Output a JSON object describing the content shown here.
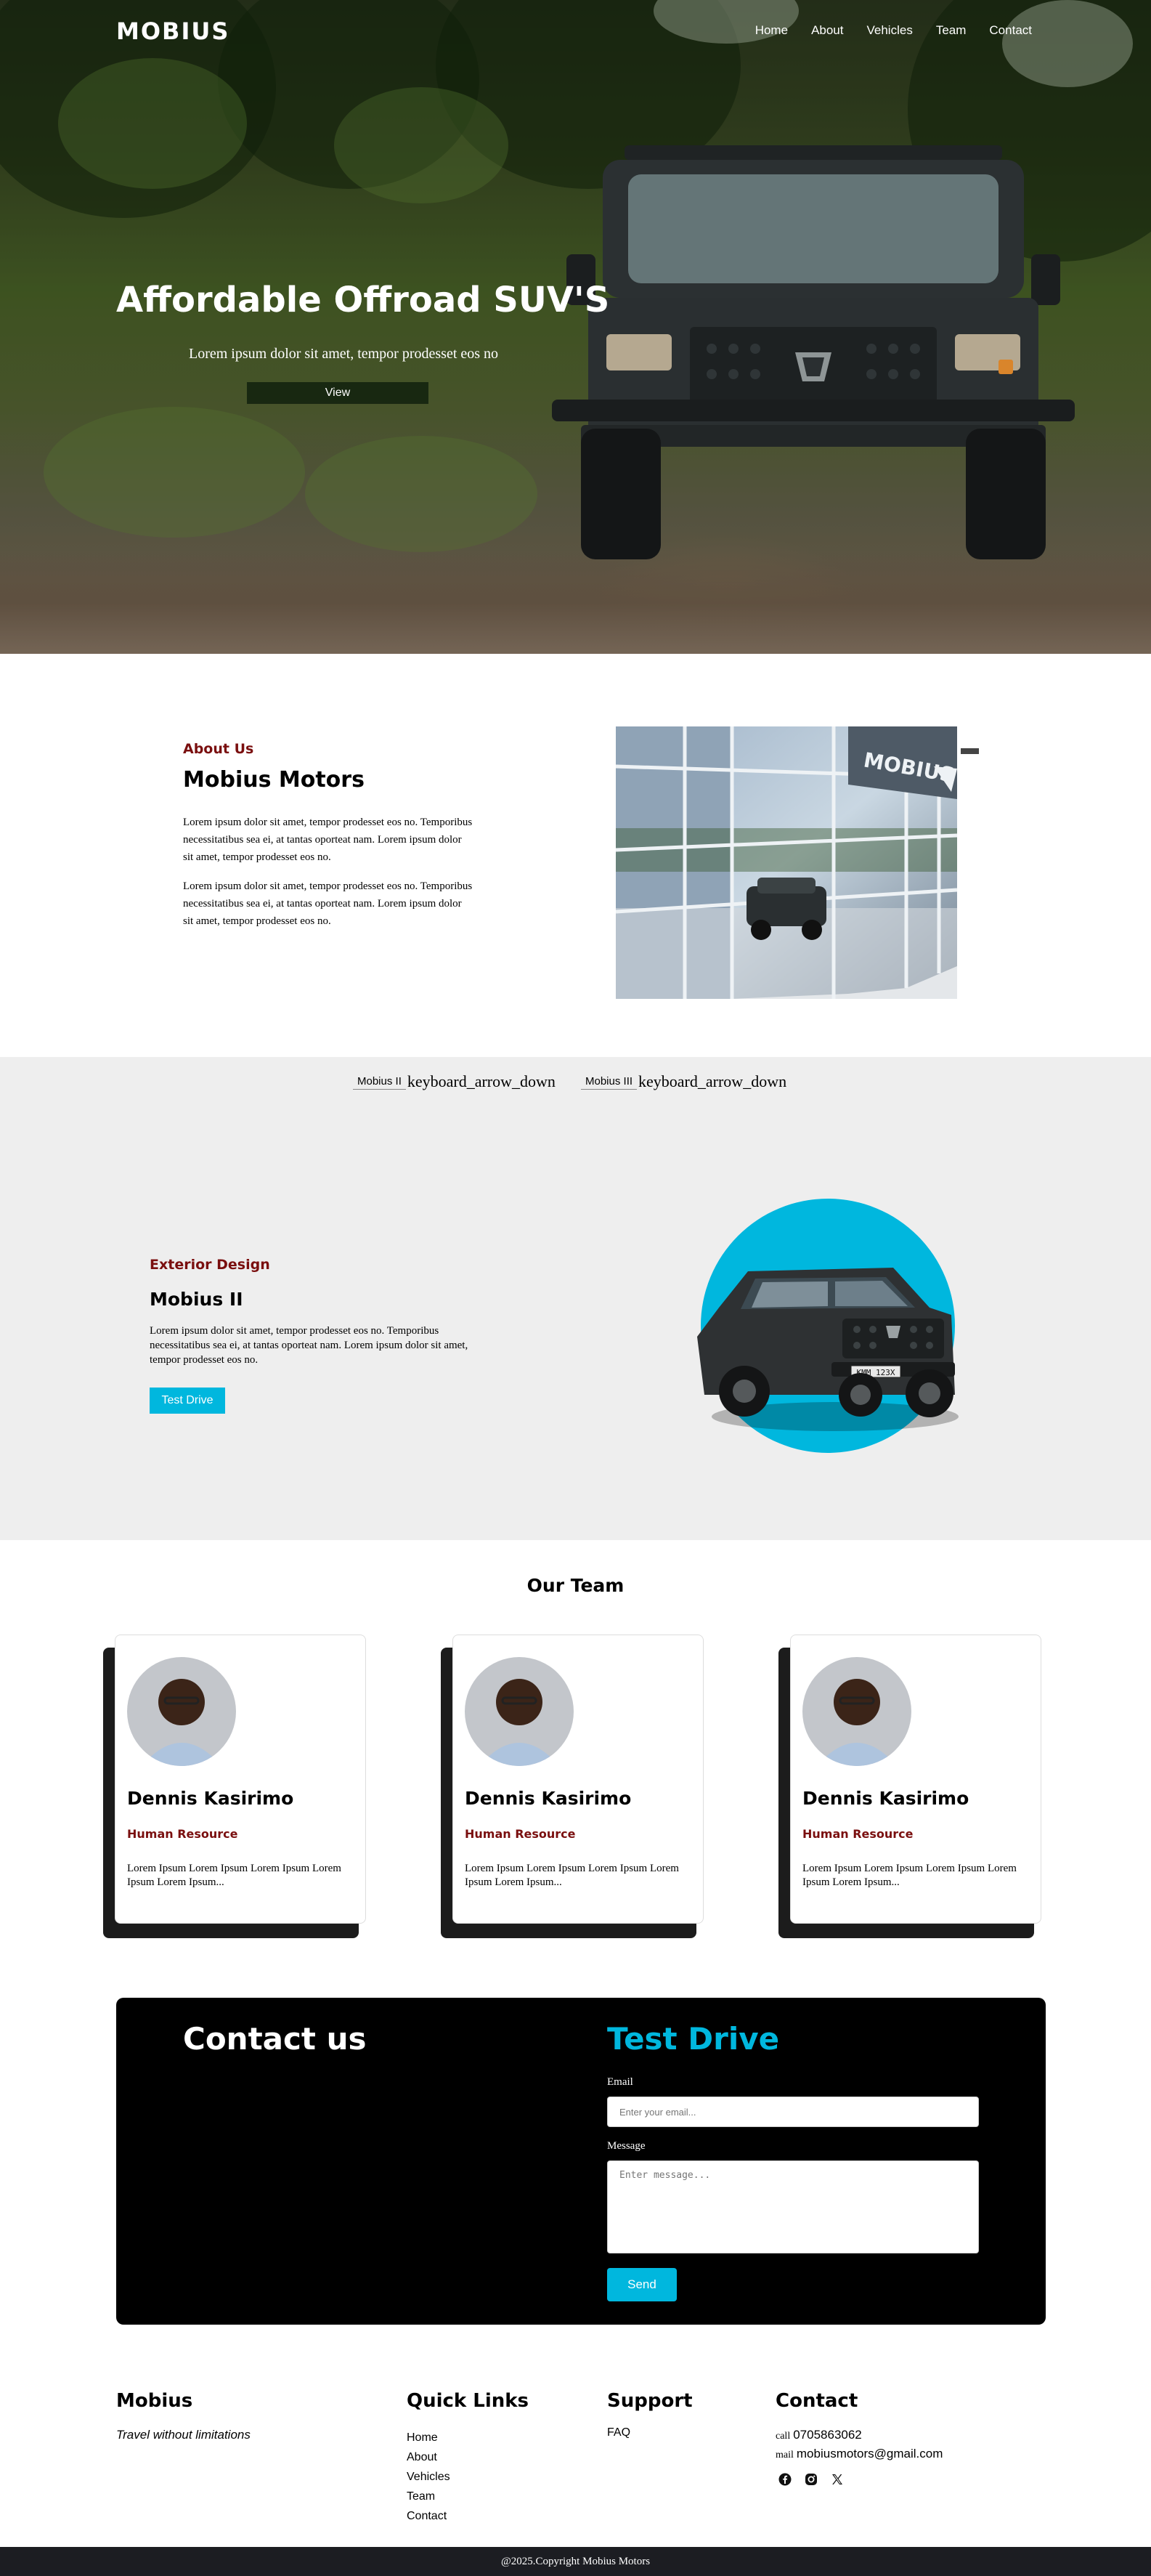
{
  "nav": {
    "logo": "MOBIUS",
    "links": [
      "Home",
      "About",
      "Vehicles",
      "Team",
      "Contact"
    ]
  },
  "hero": {
    "title": "Affordable Offroad SUV'S",
    "subtitle": "Lorem ipsum dolor sit amet, tempor prodesset eos no",
    "button": "View"
  },
  "about": {
    "label": "About Us",
    "title": "Mobius Motors",
    "paragraph1": "Lorem ipsum dolor sit amet, tempor prodesset eos no. Temporibus necessitatibus sea ei, at tantas oporteat nam. Lorem ipsum dolor sit amet, tempor prodesset eos no.",
    "paragraph2": "Lorem ipsum dolor sit amet, tempor prodesset eos no. Temporibus necessitatibus sea ei, at tantas oporteat nam. Lorem ipsum dolor sit amet, tempor prodesset eos no."
  },
  "vehicles": {
    "selectors": [
      {
        "value": "Mobius II",
        "arrow": "keyboard_arrow_down"
      },
      {
        "value": "Mobius III",
        "arrow": "keyboard_arrow_down"
      }
    ],
    "label": "Exterior Design",
    "title": "Mobius II",
    "description": "Lorem ipsum dolor sit amet, tempor prodesset eos no. Temporibus necessitatibus sea ei, at tantas oporteat nam. Lorem ipsum dolor sit amet, tempor prodesset eos no.",
    "button": "Test Drive",
    "plate": "KMM 123X",
    "circle_color": "#00b7de"
  },
  "team": {
    "title": "Our Team",
    "members": [
      {
        "name": "Dennis Kasirimo",
        "role": "Human Resource",
        "bio": "Lorem Ipsum Lorem Ipsum Lorem Ipsum Lorem Ipsum Lorem Ipsum..."
      },
      {
        "name": "Dennis Kasirimo",
        "role": "Human Resource",
        "bio": "Lorem Ipsum Lorem Ipsum Lorem Ipsum Lorem Ipsum Lorem Ipsum..."
      },
      {
        "name": "Dennis Kasirimo",
        "role": "Human Resource",
        "bio": "Lorem Ipsum Lorem Ipsum Lorem Ipsum Lorem Ipsum Lorem Ipsum..."
      }
    ]
  },
  "contact": {
    "title": "Contact us",
    "form_title": "Test Drive",
    "email_label": "Email",
    "email_placeholder": "Enter your email...",
    "message_label": "Message",
    "message_placeholder": "Enter message...",
    "send_button": "Send"
  },
  "footer": {
    "brand": "Mobius",
    "tagline": "Travel without limitations",
    "quick_links_title": "Quick Links",
    "quick_links": [
      "Home",
      "About",
      "Vehicles",
      "Team",
      "Contact"
    ],
    "support_title": "Support",
    "support_links": [
      "FAQ"
    ],
    "contact_title": "Contact",
    "call_icon": "call",
    "phone": "0705863062",
    "mail_icon": "mail",
    "email": "mobiusmotors@gmail.com",
    "socials": [
      "facebook-icon",
      "instagram-icon",
      "x-icon"
    ],
    "copyright": "@2025.Copyright Mobius Motors"
  },
  "colors": {
    "accent": "#00b7de",
    "label_red": "#7a0f0f",
    "footer_bar": "#1c1d22"
  }
}
